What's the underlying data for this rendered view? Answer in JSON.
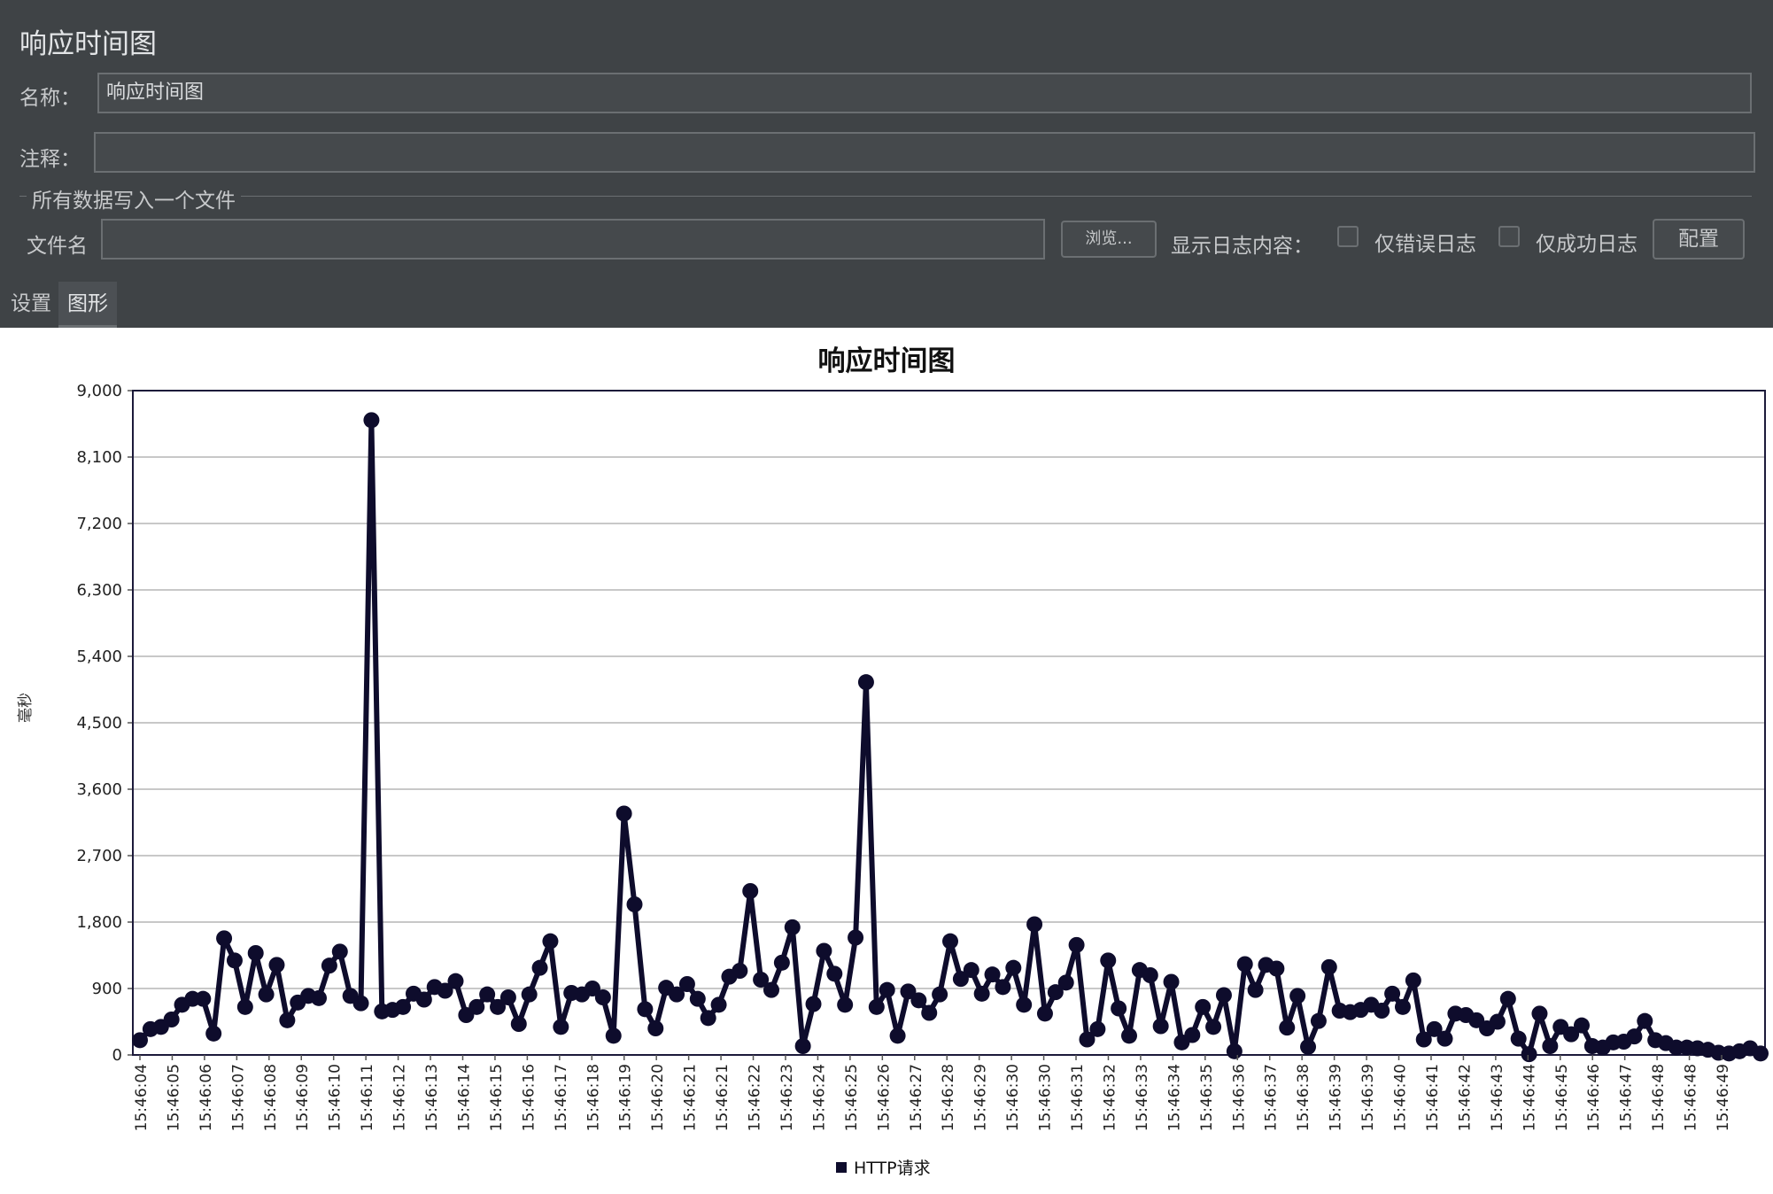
{
  "panel": {
    "title": "响应时间图",
    "name_label": "名称：",
    "name_value": "响应时间图",
    "comment_label": "注释：",
    "comment_value": "",
    "file_section_label": "所有数据写入一个文件",
    "filename_label": "文件名",
    "filename_value": "",
    "browse_label": "浏览...",
    "log_content_label": "显示日志内容：",
    "errors_only_label": "仅错误日志",
    "success_only_label": "仅成功日志",
    "configure_label": "配置",
    "tabs": [
      {
        "label": "设置",
        "active": false
      },
      {
        "label": "图形",
        "active": true
      }
    ]
  },
  "chart_data": {
    "type": "line",
    "title": "响应时间图",
    "ylabel": "毫秒",
    "xlabel": "",
    "ylim": [
      0,
      9000
    ],
    "yticks": [
      "0",
      "900",
      "1,800",
      "2,700",
      "3,600",
      "4,500",
      "5,400",
      "6,300",
      "7,200",
      "8,100",
      "9,000"
    ],
    "grid": true,
    "legend_position": "bottom",
    "color": "#0e0c2c",
    "x_tick_labels": [
      "15:46:04",
      "15:46:05",
      "15:46:06",
      "15:46:07",
      "15:46:08",
      "15:46:09",
      "15:46:10",
      "15:46:11",
      "15:46:12",
      "15:46:13",
      "15:46:14",
      "15:46:15",
      "15:46:16",
      "15:46:17",
      "15:46:18",
      "15:46:19",
      "15:46:20",
      "15:46:21",
      "15:46:21",
      "15:46:22",
      "15:46:23",
      "15:46:24",
      "15:46:25",
      "15:46:26",
      "15:46:27",
      "15:46:28",
      "15:46:29",
      "15:46:30",
      "15:46:30",
      "15:46:31",
      "15:46:32",
      "15:46:33",
      "15:46:34",
      "15:46:35",
      "15:46:36",
      "15:46:37",
      "15:46:38",
      "15:46:39",
      "15:46:39",
      "15:46:40",
      "15:46:41",
      "15:46:42",
      "15:46:43",
      "15:46:44",
      "15:46:45",
      "15:46:46",
      "15:46:47",
      "15:46:48",
      "15:46:48",
      "15:46:49"
    ],
    "series": [
      {
        "name": "HTTP请求",
        "values": [
          200,
          350,
          380,
          480,
          680,
          760,
          760,
          290,
          1580,
          1280,
          650,
          1380,
          820,
          1220,
          470,
          710,
          800,
          770,
          1210,
          1400,
          800,
          700,
          8600,
          590,
          610,
          650,
          830,
          750,
          920,
          870,
          1000,
          540,
          650,
          820,
          650,
          780,
          420,
          820,
          1180,
          1540,
          380,
          840,
          820,
          900,
          780,
          260,
          3270,
          2040,
          620,
          360,
          910,
          820,
          960,
          760,
          500,
          680,
          1060,
          1140,
          2220,
          1020,
          880,
          1250,
          1730,
          120,
          690,
          1410,
          1100,
          680,
          1590,
          5050,
          650,
          880,
          260,
          860,
          740,
          570,
          820,
          1540,
          1030,
          1150,
          830,
          1090,
          920,
          1180,
          680,
          1770,
          560,
          850,
          980,
          1490,
          210,
          350,
          1280,
          630,
          260,
          1150,
          1080,
          390,
          990,
          170,
          270,
          650,
          380,
          810,
          50,
          1230,
          880,
          1220,
          1170,
          370,
          800,
          110,
          460,
          1190,
          600,
          580,
          610,
          680,
          600,
          830,
          650,
          1010,
          210,
          350,
          220,
          560,
          540,
          470,
          360,
          450,
          760,
          220,
          10,
          560,
          120,
          380,
          280,
          400,
          120,
          100,
          170,
          180,
          250,
          460,
          200,
          160,
          100,
          100,
          90,
          70,
          30,
          20,
          50,
          90,
          20
        ]
      }
    ]
  }
}
